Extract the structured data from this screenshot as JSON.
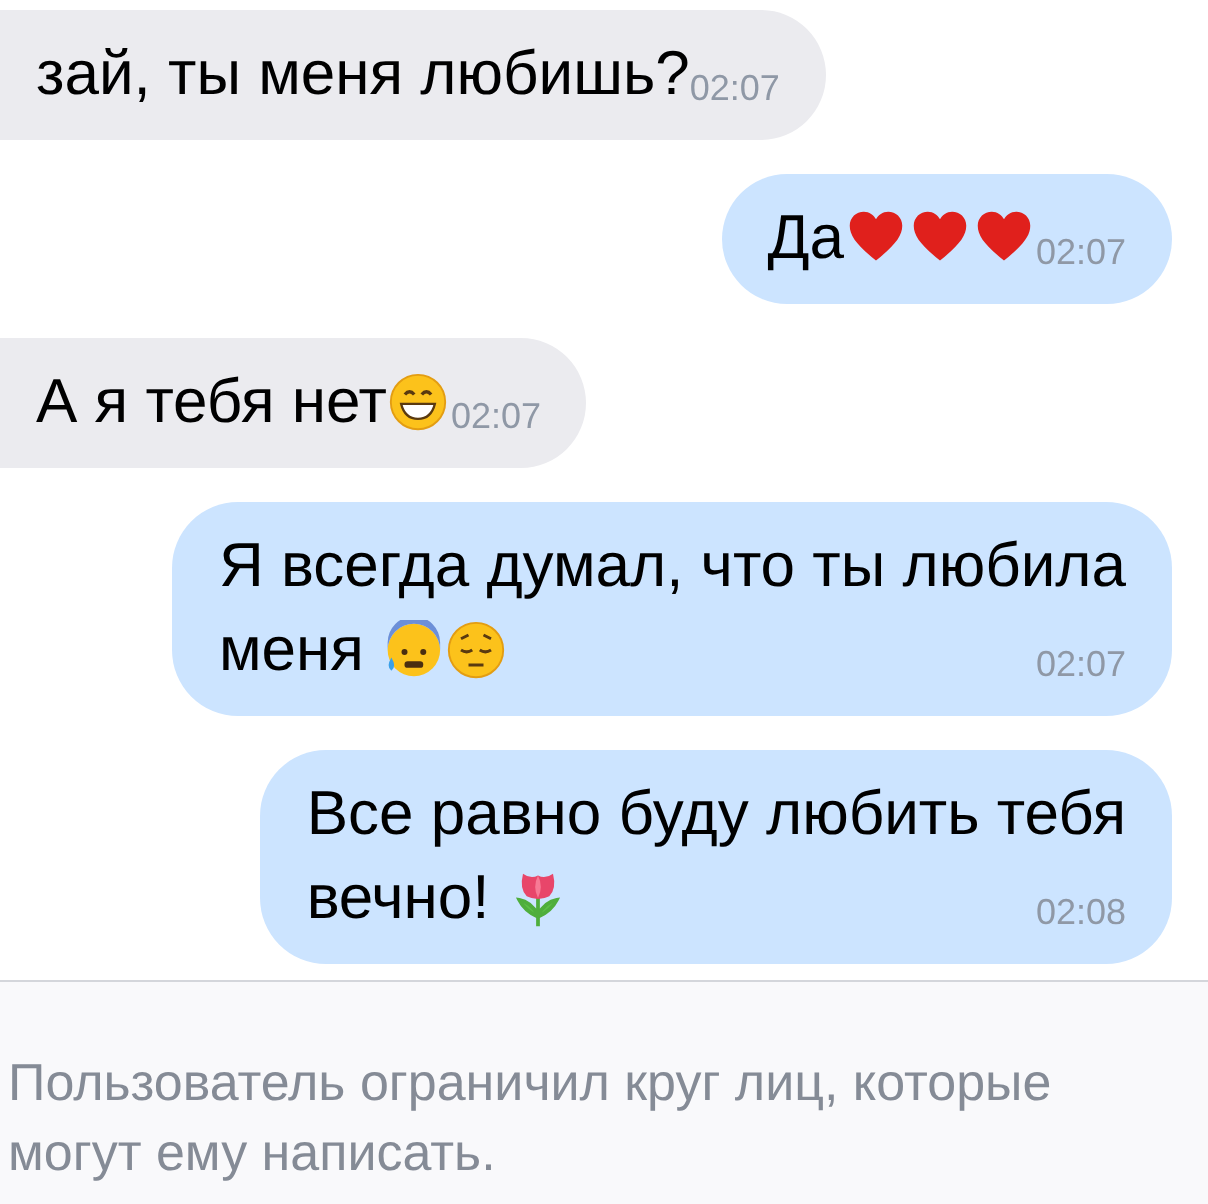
{
  "messages": [
    {
      "kind": "incoming",
      "lines": [
        "зай, ты меня любишь?"
      ],
      "time": "02:07"
    },
    {
      "kind": "outgoing",
      "lines": [
        "Да"
      ],
      "emojis": [
        {
          "kind": "heart"
        },
        {
          "kind": "heart"
        },
        {
          "kind": "heart"
        }
      ],
      "time": "02:07"
    },
    {
      "kind": "incoming",
      "lines": [
        "А я тебя нет"
      ],
      "emojis": [
        {
          "kind": "grin"
        }
      ],
      "time": "02:07"
    },
    {
      "kind": "outgoing",
      "lines": [
        "Я всегда думал, что ты любила",
        "меня"
      ],
      "emojis": [
        {
          "kind": "sweat"
        },
        {
          "kind": "pensive"
        }
      ],
      "time": "02:07"
    },
    {
      "kind": "outgoing",
      "lines": [
        "Все равно буду любить тебя",
        "вечно!"
      ],
      "emojis": [
        {
          "kind": "tulip"
        }
      ],
      "time": "02:08"
    }
  ],
  "footer": {
    "notice": "Пользователь ограничил круг лиц, которые могут ему написать."
  }
}
